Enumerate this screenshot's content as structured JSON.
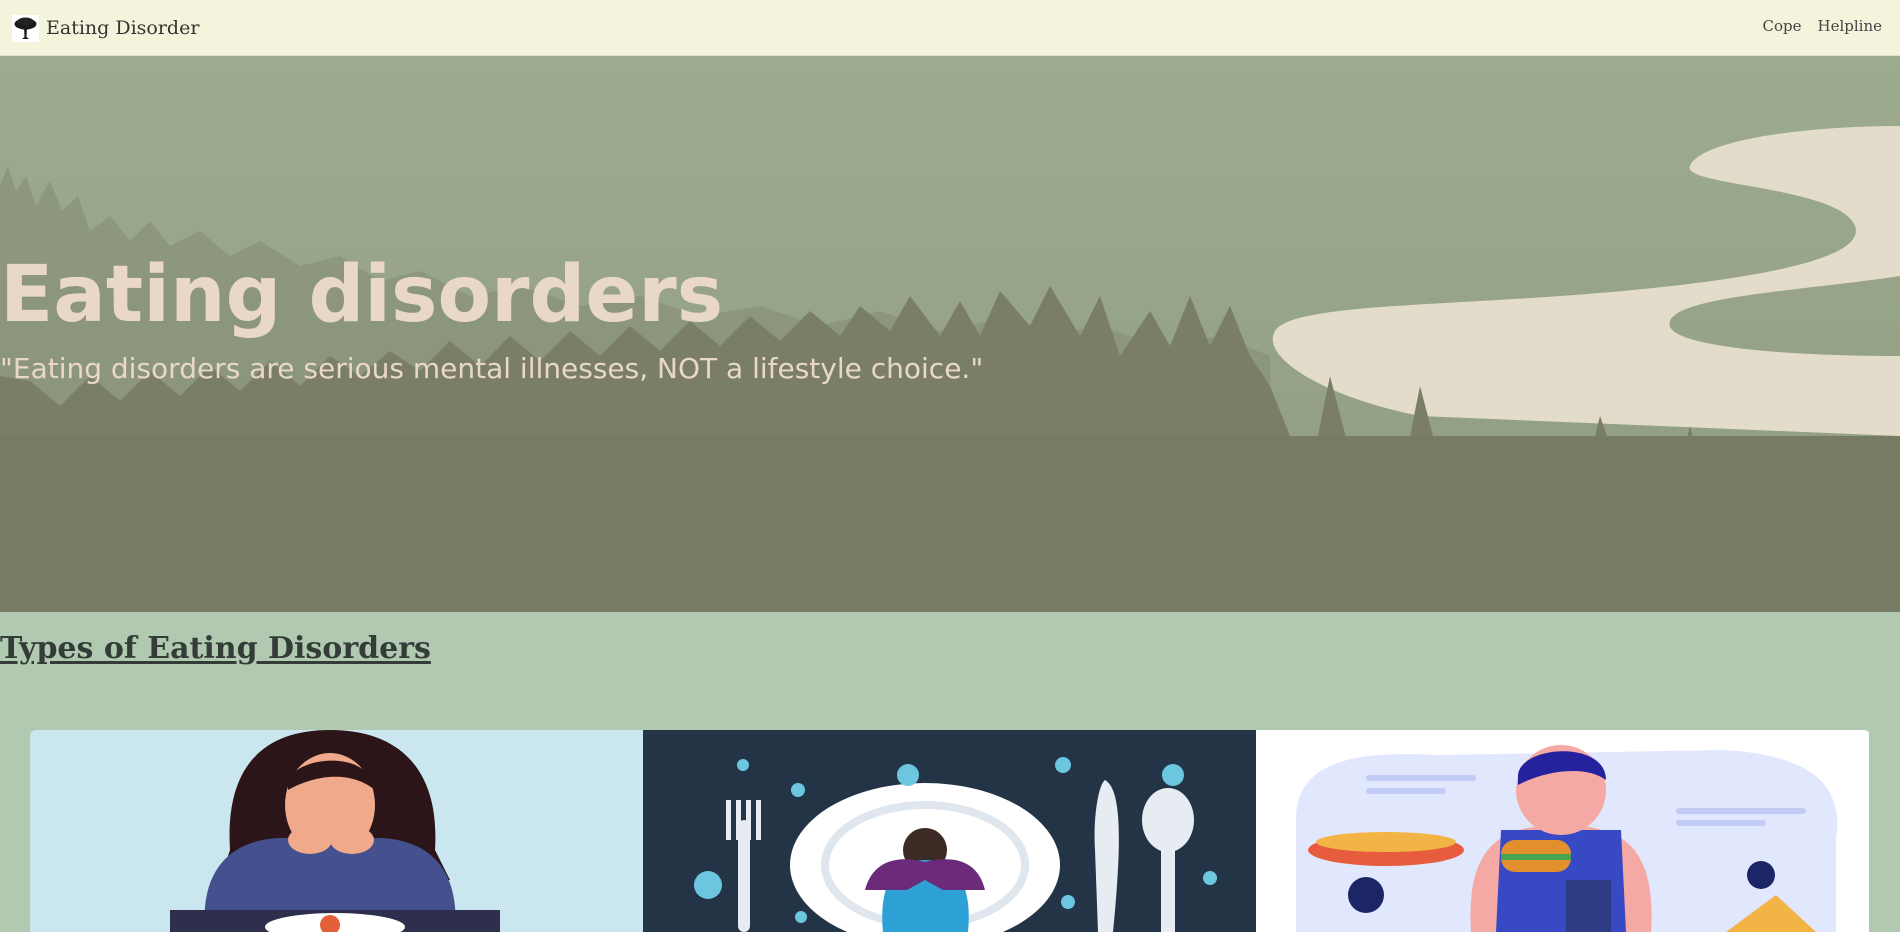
{
  "navbar": {
    "brand_icon": "tree-icon",
    "brand_label": "Eating Disorder",
    "links": [
      {
        "label": "Cope"
      },
      {
        "label": "Helpline"
      }
    ]
  },
  "hero": {
    "title": "Eating disorders",
    "quote": "\"Eating disorders are serious mental illnesses, NOT a lifestyle choice.\""
  },
  "section": {
    "heading": "Types of Eating Disorders"
  },
  "cards": [
    {
      "image": "sad-woman-at-dinner-table-illustration"
    },
    {
      "image": "woman-curled-on-plate-with-cutlery-illustration"
    },
    {
      "image": "man-overeating-fast-food-illustration"
    }
  ],
  "colors": {
    "navbar_bg": "#f4f4dc",
    "hero_sky": "#9aaa8c",
    "hero_forest": "#7a7e66",
    "hero_text": "#e9d8c8",
    "page_bg": "#b1c9b1",
    "heading_text": "#333c36"
  }
}
